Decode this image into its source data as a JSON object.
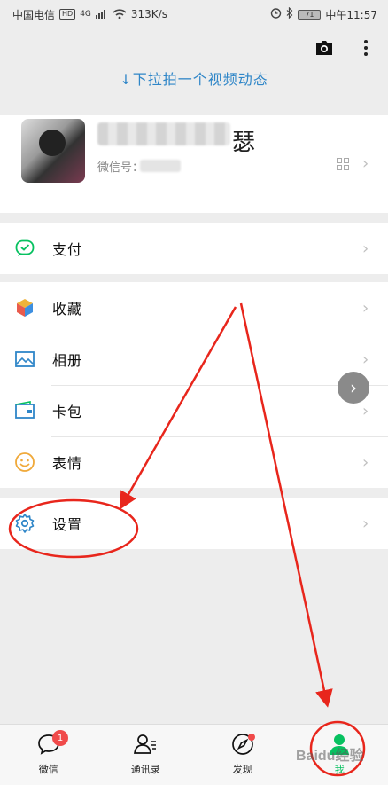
{
  "status": {
    "carrier": "中国电信",
    "hd": "HD",
    "net": "4G",
    "speed": "313K/s",
    "battery": "71",
    "time": "中午11:57"
  },
  "header": {
    "pull_hint": "↓下拉拍一个视频动态",
    "camera_icon": "camera-icon",
    "more_icon": "more-vertical-icon"
  },
  "profile": {
    "nickname_suffix": "瑟",
    "wechat_id_label": "微信号："
  },
  "menu": {
    "pay": "支付",
    "favorites": "收藏",
    "album": "相册",
    "cards": "卡包",
    "stickers": "表情",
    "settings": "设置"
  },
  "tabbar": {
    "chats": "微信",
    "chats_badge": "1",
    "contacts": "通讯录",
    "discover": "发现",
    "me": "我"
  },
  "watermark": "Baidu经验",
  "colors": {
    "accent_green": "#07c160",
    "link_blue": "#2f86c8",
    "annotation_red": "#e8261c"
  }
}
